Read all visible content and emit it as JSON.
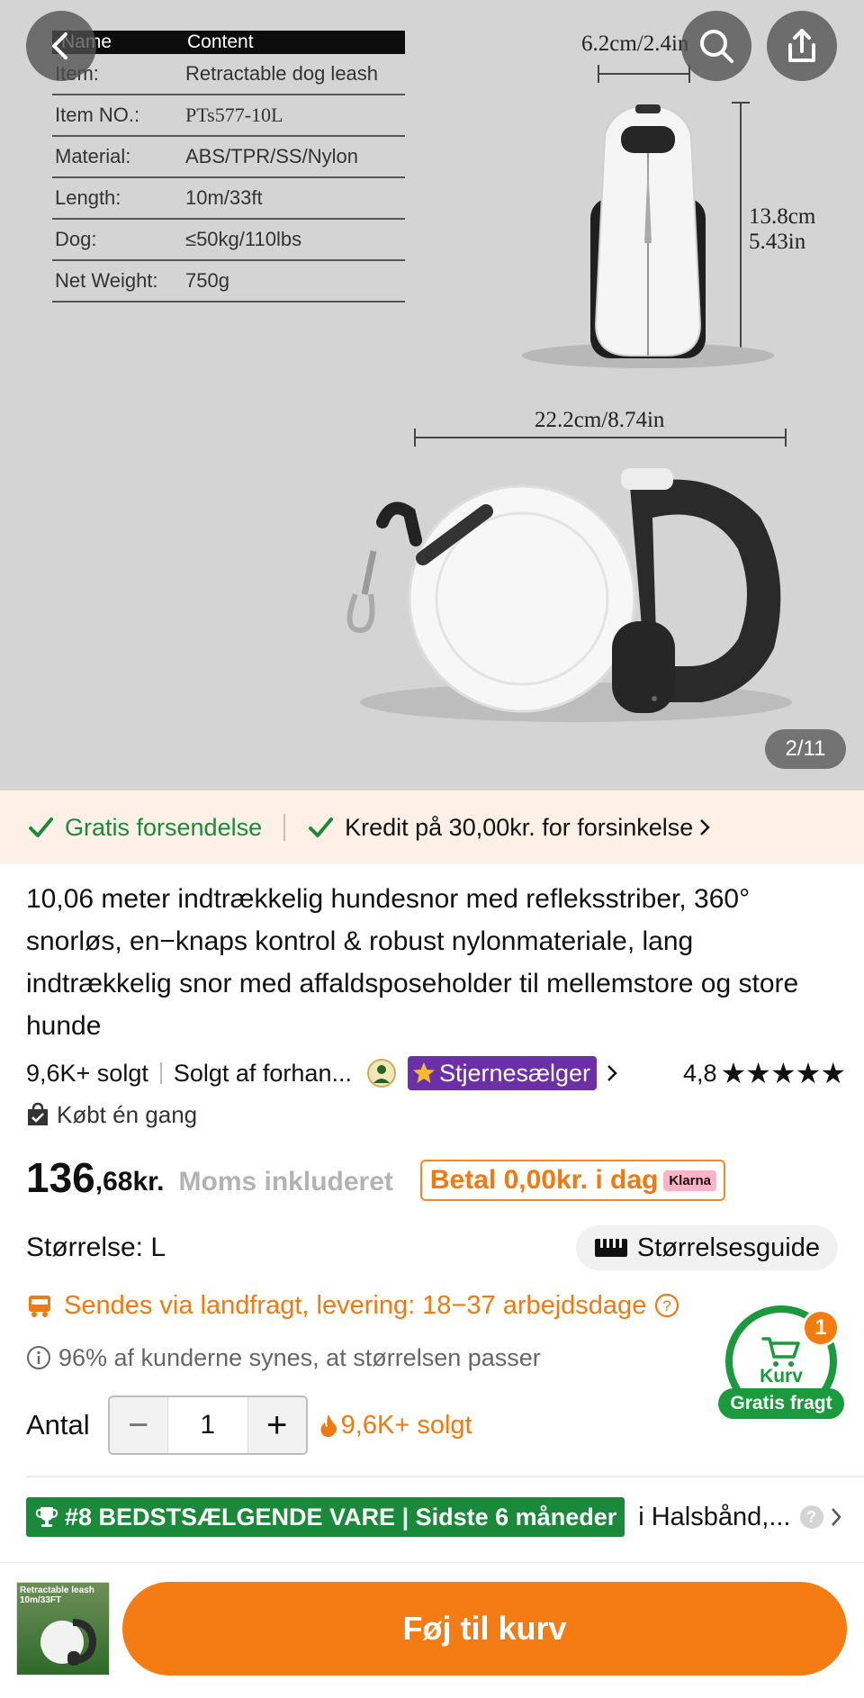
{
  "hero": {
    "spec_table": {
      "head_name": "Name",
      "head_content": "Content",
      "rows": [
        {
          "key": "Item:",
          "value": "Retractable dog leash"
        },
        {
          "key": "Item NO.:",
          "value": "PTs577-10L"
        },
        {
          "key": "Material:",
          "value": "ABS/TPR/SS/Nylon"
        },
        {
          "key": "Length:",
          "value": "10m/33ft"
        },
        {
          "key": "Dog:",
          "value": "≤50kg/110lbs"
        },
        {
          "key": "Net Weight:",
          "value": "750g"
        }
      ]
    },
    "dim_width_top": "6.2cm/2.4in",
    "dim_height_cm": "13.8cm",
    "dim_height_in": "5.43in",
    "dim_length": "22.2cm/8.74in",
    "counter": "2/11",
    "icons": {
      "back": "back-arrow-icon",
      "search": "search-icon",
      "share": "share-icon"
    }
  },
  "promo": {
    "free_shipping": "Gratis forsendelse",
    "credit": "Kredit på 30,00kr. for forsinkelse"
  },
  "product": {
    "title": "10,06 meter indtrækkelig hundesnor med refleksstriber, 360° snorløs, en−knaps kontrol & robust nylonmateriale, lang indtrækkelig snor med affaldsposeholder til mellemstore og store hunde",
    "sold": "9,6K+ solgt",
    "seller": "Solgt af forhan...",
    "star_seller": "Stjernesælger",
    "rating": "4,8",
    "stars": "★★★★★",
    "bought_once": "Købt én gang",
    "price_whole": "136",
    "price_fraction": ",68kr.",
    "vat": "Moms inkluderet",
    "pay_today": "Betal 0,00kr. i dag",
    "klarna": "Klarna",
    "size_label": "Størrelse: L",
    "size_guide": "Størrelsesguide",
    "shipping": "Sendes via landfragt, levering: 18−37 arbejdsdage",
    "fit": "96% af kunderne synes, at størrelsen passer",
    "qty_label": "Antal",
    "qty_value": "1",
    "qty_minus": "−",
    "qty_plus": "+",
    "hot_sold": "9,6K+ solgt",
    "bestseller": "#8 BEDSTSÆLGENDE VARE | Sidste 6 måneder",
    "category": "i Halsbånd,...",
    "help": "?"
  },
  "cart_float": {
    "count": "1",
    "label": "Kurv",
    "free": "Gratis fragt"
  },
  "bottom": {
    "thumb_caption_1": "Retractable leash",
    "thumb_caption_2": "10m/33FT",
    "add_to_cart": "Føj til kurv"
  },
  "colors": {
    "accent_orange": "#f57c13",
    "green": "#1a8a3a",
    "purple": "#6b2fa7",
    "promo_bg": "#fdf0e6"
  }
}
